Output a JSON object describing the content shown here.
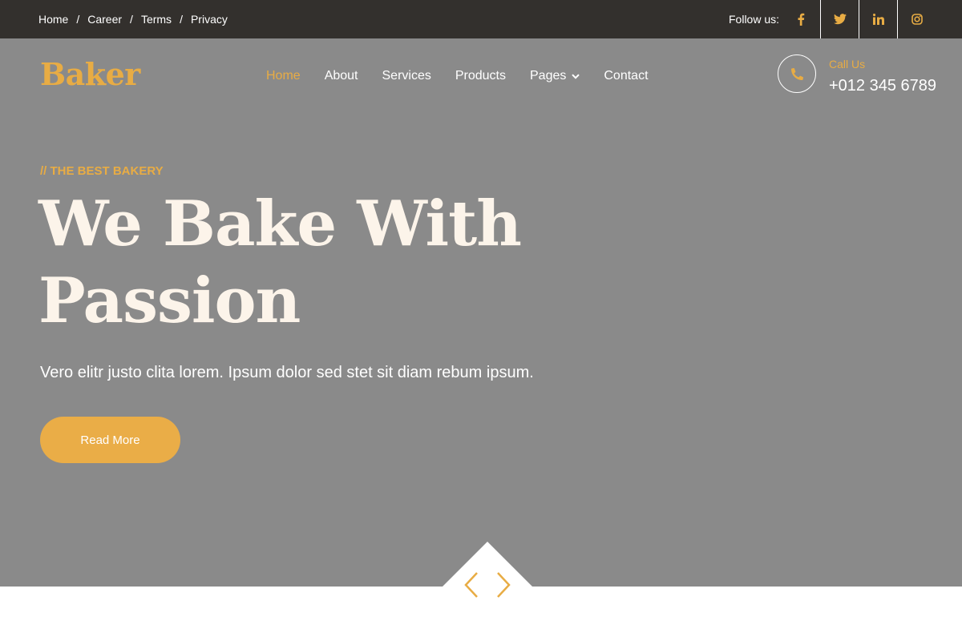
{
  "topbar": {
    "links": [
      "Home",
      "Career",
      "Terms",
      "Privacy"
    ],
    "separator": "/",
    "follow_label": "Follow us:",
    "social": [
      "facebook-icon",
      "twitter-icon",
      "linkedin-icon",
      "instagram-icon"
    ]
  },
  "header": {
    "logo": "Baker",
    "nav": [
      {
        "label": "Home",
        "active": true
      },
      {
        "label": "About"
      },
      {
        "label": "Services"
      },
      {
        "label": "Products"
      },
      {
        "label": "Pages",
        "dropdown": true
      },
      {
        "label": "Contact"
      }
    ],
    "call": {
      "label": "Call Us",
      "number": "+012 345 6789",
      "icon": "phone-icon"
    }
  },
  "hero": {
    "eyebrow": "// THE BEST BAKERY",
    "headline_line1": "We Bake With",
    "headline_line2": "Passion",
    "subtitle": "Vero elitr justo clita lorem. Ipsum dolor sed stet sit diam rebum ipsum.",
    "button": "Read More"
  },
  "carousel": {
    "prev_icon": "chevron-left-icon",
    "next_icon": "chevron-right-icon"
  },
  "colors": {
    "accent": "#e8ac44",
    "topbar": "#33302d",
    "hero_bg": "#8a8a8a",
    "headline": "#fcf4ea"
  }
}
